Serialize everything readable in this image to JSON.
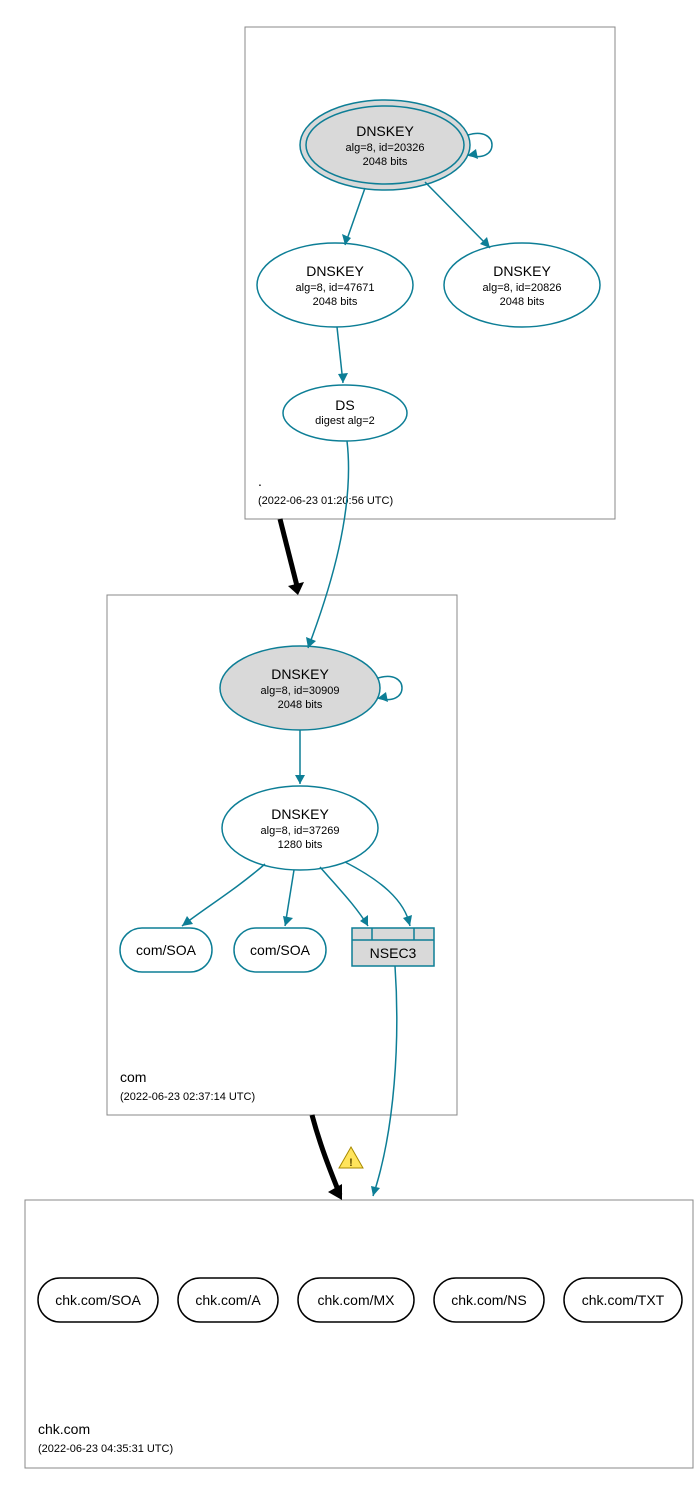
{
  "chart_data": {
    "type": "diagram",
    "zones": [
      {
        "name": ".",
        "timestamp": "(2022-06-23 01:20:56 UTC)"
      },
      {
        "name": "com",
        "timestamp": "(2022-06-23 02:37:14 UTC)"
      },
      {
        "name": "chk.com",
        "timestamp": "(2022-06-23 04:35:31 UTC)"
      }
    ],
    "nodes": {
      "root_ksk": {
        "title": "DNSKEY",
        "line1": "alg=8, id=20326",
        "line2": "2048 bits"
      },
      "root_zsk": {
        "title": "DNSKEY",
        "line1": "alg=8, id=47671",
        "line2": "2048 bits"
      },
      "root_dnskey3": {
        "title": "DNSKEY",
        "line1": "alg=8, id=20826",
        "line2": "2048 bits"
      },
      "root_ds": {
        "title": "DS",
        "line1": "digest alg=2"
      },
      "com_ksk": {
        "title": "DNSKEY",
        "line1": "alg=8, id=30909",
        "line2": "2048 bits"
      },
      "com_zsk": {
        "title": "DNSKEY",
        "line1": "alg=8, id=37269",
        "line2": "1280 bits"
      },
      "com_soa1": {
        "title": "com/SOA"
      },
      "com_soa2": {
        "title": "com/SOA"
      },
      "com_nsec3": {
        "title": "NSEC3"
      },
      "chk_soa": {
        "title": "chk.com/SOA"
      },
      "chk_a": {
        "title": "chk.com/A"
      },
      "chk_mx": {
        "title": "chk.com/MX"
      },
      "chk_ns": {
        "title": "chk.com/NS"
      },
      "chk_txt": {
        "title": "chk.com/TXT"
      }
    }
  }
}
